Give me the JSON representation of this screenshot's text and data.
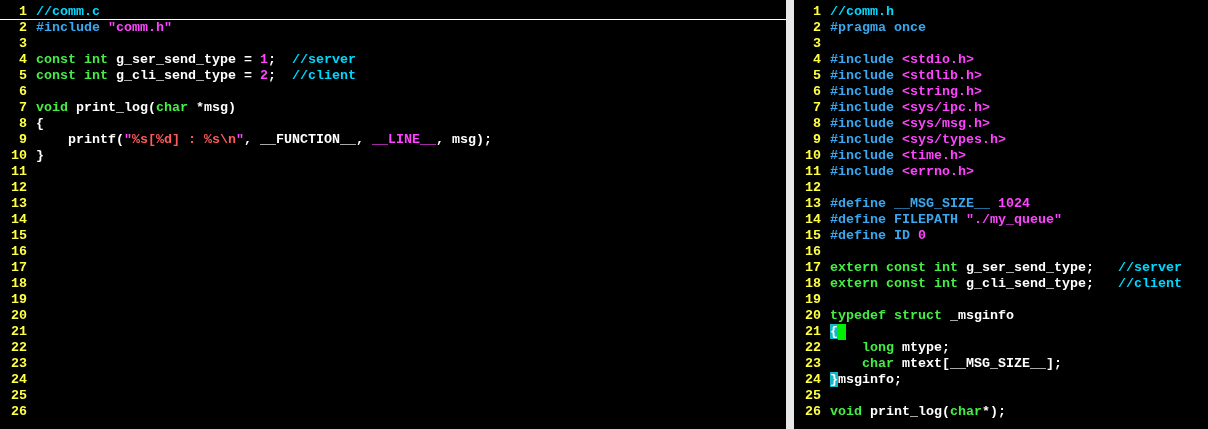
{
  "panes": [
    {
      "lines": [
        {
          "number": "1",
          "cursorline": true,
          "segments": [
            {
              "kind": "comment",
              "text": "//comm.c"
            }
          ]
        },
        {
          "number": "2",
          "segments": [
            {
              "kind": "preproc",
              "text": "#include "
            },
            {
              "kind": "string",
              "text": "\"comm.h\""
            }
          ]
        },
        {
          "number": "3"
        },
        {
          "number": "4",
          "segments": [
            {
              "kind": "type",
              "text": "const int"
            },
            {
              "kind": "plain",
              "text": " g_ser_send_type = "
            },
            {
              "kind": "string",
              "text": "1"
            },
            {
              "kind": "plain",
              "text": ";  "
            },
            {
              "kind": "comment",
              "text": "//server"
            }
          ]
        },
        {
          "number": "5",
          "segments": [
            {
              "kind": "type",
              "text": "const int"
            },
            {
              "kind": "plain",
              "text": " g_cli_send_type = "
            },
            {
              "kind": "string",
              "text": "2"
            },
            {
              "kind": "plain",
              "text": ";  "
            },
            {
              "kind": "comment",
              "text": "//client"
            }
          ]
        },
        {
          "number": "6"
        },
        {
          "number": "7",
          "segments": [
            {
              "kind": "type",
              "text": "void"
            },
            {
              "kind": "plain",
              "text": " print_log("
            },
            {
              "kind": "type",
              "text": "char"
            },
            {
              "kind": "plain",
              "text": " *msg)"
            }
          ]
        },
        {
          "number": "8",
          "segments": [
            {
              "kind": "plain",
              "text": "{"
            }
          ]
        },
        {
          "number": "9",
          "segments": [
            {
              "kind": "plain",
              "text": "    printf("
            },
            {
              "kind": "string",
              "text": "\""
            },
            {
              "kind": "special",
              "text": "%s[%d] : %s\\n"
            },
            {
              "kind": "string",
              "text": "\""
            },
            {
              "kind": "plain",
              "text": ", __FUNCTION__, "
            },
            {
              "kind": "string",
              "text": "__LINE__"
            },
            {
              "kind": "plain",
              "text": ", msg);"
            }
          ]
        },
        {
          "number": "10",
          "segments": [
            {
              "kind": "plain",
              "text": "}"
            }
          ]
        },
        {
          "number": "11"
        },
        {
          "number": "12"
        },
        {
          "number": "13"
        },
        {
          "number": "14"
        },
        {
          "number": "15"
        },
        {
          "number": "16"
        },
        {
          "number": "17"
        },
        {
          "number": "18"
        },
        {
          "number": "19"
        },
        {
          "number": "20"
        },
        {
          "number": "21"
        },
        {
          "number": "22"
        },
        {
          "number": "23"
        },
        {
          "number": "24"
        },
        {
          "number": "25"
        },
        {
          "number": "26"
        }
      ]
    },
    {
      "lines": [
        {
          "number": "1",
          "segments": [
            {
              "kind": "comment",
              "text": "//comm.h"
            }
          ]
        },
        {
          "number": "2",
          "segments": [
            {
              "kind": "preproc",
              "text": "#pragma once"
            }
          ]
        },
        {
          "number": "3"
        },
        {
          "number": "4",
          "segments": [
            {
              "kind": "preproc",
              "text": "#include "
            },
            {
              "kind": "string",
              "text": "<stdio.h>"
            }
          ]
        },
        {
          "number": "5",
          "segments": [
            {
              "kind": "preproc",
              "text": "#include "
            },
            {
              "kind": "string",
              "text": "<stdlib.h>"
            }
          ]
        },
        {
          "number": "6",
          "segments": [
            {
              "kind": "preproc",
              "text": "#include "
            },
            {
              "kind": "string",
              "text": "<string.h>"
            }
          ]
        },
        {
          "number": "7",
          "segments": [
            {
              "kind": "preproc",
              "text": "#include "
            },
            {
              "kind": "string",
              "text": "<sys/ipc.h>"
            }
          ]
        },
        {
          "number": "8",
          "segments": [
            {
              "kind": "preproc",
              "text": "#include "
            },
            {
              "kind": "string",
              "text": "<sys/msg.h>"
            }
          ]
        },
        {
          "number": "9",
          "segments": [
            {
              "kind": "preproc",
              "text": "#include "
            },
            {
              "kind": "string",
              "text": "<sys/types.h>"
            }
          ]
        },
        {
          "number": "10",
          "segments": [
            {
              "kind": "preproc",
              "text": "#include "
            },
            {
              "kind": "string",
              "text": "<time.h>"
            }
          ]
        },
        {
          "number": "11",
          "segments": [
            {
              "kind": "preproc",
              "text": "#include "
            },
            {
              "kind": "string",
              "text": "<errno.h>"
            }
          ]
        },
        {
          "number": "12"
        },
        {
          "number": "13",
          "segments": [
            {
              "kind": "preproc",
              "text": "#define __MSG_SIZE__ "
            },
            {
              "kind": "string",
              "text": "1024"
            }
          ]
        },
        {
          "number": "14",
          "segments": [
            {
              "kind": "preproc",
              "text": "#define FILEPATH "
            },
            {
              "kind": "string",
              "text": "\"./my_queue\""
            }
          ]
        },
        {
          "number": "15",
          "segments": [
            {
              "kind": "preproc",
              "text": "#define ID "
            },
            {
              "kind": "string",
              "text": "0"
            }
          ]
        },
        {
          "number": "16"
        },
        {
          "number": "17",
          "segments": [
            {
              "kind": "type",
              "text": "extern const int"
            },
            {
              "kind": "plain",
              "text": " g_ser_send_type;   "
            },
            {
              "kind": "comment",
              "text": "//server"
            }
          ]
        },
        {
          "number": "18",
          "segments": [
            {
              "kind": "type",
              "text": "extern const int"
            },
            {
              "kind": "plain",
              "text": " g_cli_send_type;   "
            },
            {
              "kind": "comment",
              "text": "//client"
            }
          ]
        },
        {
          "number": "19"
        },
        {
          "number": "20",
          "segments": [
            {
              "kind": "type",
              "text": "typedef struct"
            },
            {
              "kind": "plain",
              "text": " _msginfo"
            }
          ]
        },
        {
          "number": "21",
          "cursor": true,
          "segments": [
            {
              "kind": "match",
              "text": "{"
            }
          ]
        },
        {
          "number": "22",
          "segments": [
            {
              "kind": "type",
              "text": "    long"
            },
            {
              "kind": "plain",
              "text": " mtype;"
            }
          ]
        },
        {
          "number": "23",
          "segments": [
            {
              "kind": "type",
              "text": "    char"
            },
            {
              "kind": "plain",
              "text": " mtext[__MSG_SIZE__];"
            }
          ]
        },
        {
          "number": "24",
          "segments": [
            {
              "kind": "match",
              "text": "}"
            },
            {
              "kind": "plain",
              "text": "msginfo;"
            }
          ]
        },
        {
          "number": "25"
        },
        {
          "number": "26",
          "segments": [
            {
              "kind": "type",
              "text": "void"
            },
            {
              "kind": "plain",
              "text": " print_log("
            },
            {
              "kind": "type",
              "text": "char"
            },
            {
              "kind": "plain",
              "text": "*);"
            }
          ]
        }
      ]
    }
  ]
}
